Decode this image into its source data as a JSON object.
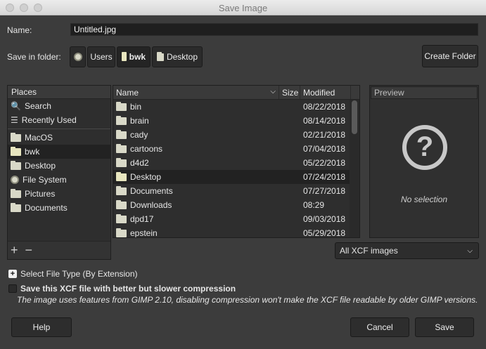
{
  "window": {
    "title": "Save Image"
  },
  "name": {
    "label": "Name:",
    "value": "Untitled.jpg"
  },
  "folder": {
    "label": "Save in folder:",
    "breadcrumb": [
      "Users",
      "bwk",
      "Desktop"
    ],
    "create_label": "Create Folder"
  },
  "places": {
    "header": "Places",
    "items": [
      {
        "label": "Search",
        "icon": "search-icon"
      },
      {
        "label": "Recently Used",
        "icon": "recent-icon"
      },
      {
        "label": "MacOS",
        "icon": "drive-icon"
      },
      {
        "label": "bwk",
        "icon": "folder-icon"
      },
      {
        "label": "Desktop",
        "icon": "folder-icon"
      },
      {
        "label": "File System",
        "icon": "filesystem-icon"
      },
      {
        "label": "Pictures",
        "icon": "folder-icon"
      },
      {
        "label": "Documents",
        "icon": "folder-icon"
      }
    ]
  },
  "files": {
    "columns": [
      "Name",
      "Size",
      "Modified"
    ],
    "rows": [
      {
        "name": "bin",
        "size": "",
        "modified": "08/22/2018"
      },
      {
        "name": "brain",
        "size": "",
        "modified": "08/14/2018"
      },
      {
        "name": "cady",
        "size": "",
        "modified": "02/21/2018"
      },
      {
        "name": "cartoons",
        "size": "",
        "modified": "07/04/2018"
      },
      {
        "name": "d4d2",
        "size": "",
        "modified": "05/22/2018"
      },
      {
        "name": "Desktop",
        "size": "",
        "modified": "07/24/2018"
      },
      {
        "name": "Documents",
        "size": "",
        "modified": "07/27/2018"
      },
      {
        "name": "Downloads",
        "size": "",
        "modified": "08:29"
      },
      {
        "name": "dpd17",
        "size": "",
        "modified": "09/03/2018"
      },
      {
        "name": "epstein",
        "size": "",
        "modified": "05/29/2018"
      }
    ]
  },
  "preview": {
    "header": "Preview",
    "empty": "No selection"
  },
  "filetype": {
    "value": "All XCF images"
  },
  "options": {
    "select_type": "Select File Type (By Extension)",
    "compression": "Save this XCF file with better but slower compression",
    "note": "The image uses features from GIMP 2.10, disabling compression won't make the XCF file readable by older GIMP versions."
  },
  "buttons": {
    "help": "Help",
    "cancel": "Cancel",
    "save": "Save"
  }
}
